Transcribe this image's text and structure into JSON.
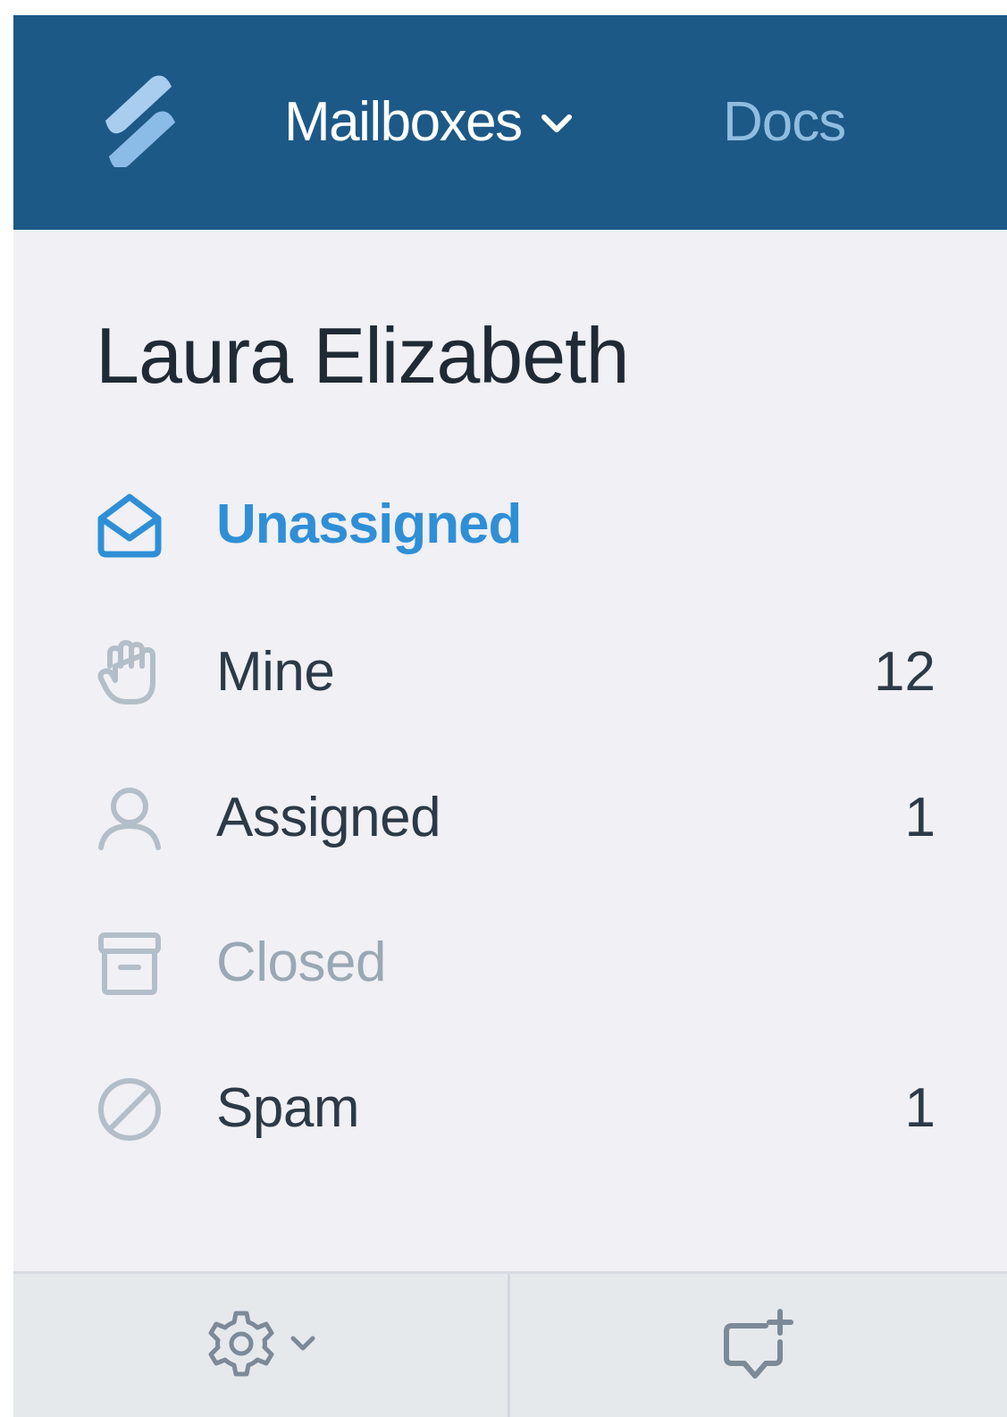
{
  "header": {
    "mailboxes_label": "Mailboxes",
    "docs_label": "Docs"
  },
  "mailbox": {
    "title": "Laura Elizabeth"
  },
  "folders": [
    {
      "label": "Unassigned",
      "count": "",
      "icon": "envelope-open-icon",
      "state": "active"
    },
    {
      "label": "Mine",
      "count": "12",
      "icon": "hand-icon",
      "state": "normal"
    },
    {
      "label": "Assigned",
      "count": "1",
      "icon": "user-icon",
      "state": "normal"
    },
    {
      "label": "Closed",
      "count": "",
      "icon": "archive-box-icon",
      "state": "muted"
    },
    {
      "label": "Spam",
      "count": "1",
      "icon": "block-icon",
      "state": "normal"
    }
  ],
  "footer": {
    "settings_icon": "gear-icon",
    "new_conversation_icon": "chat-plus-icon"
  },
  "colors": {
    "header_bg": "#1d5986",
    "active_blue": "#2f8fd6",
    "docs_link": "#8fbde0",
    "sidebar_bg": "#f0f0f5",
    "footer_bg": "#e5e9ec"
  }
}
